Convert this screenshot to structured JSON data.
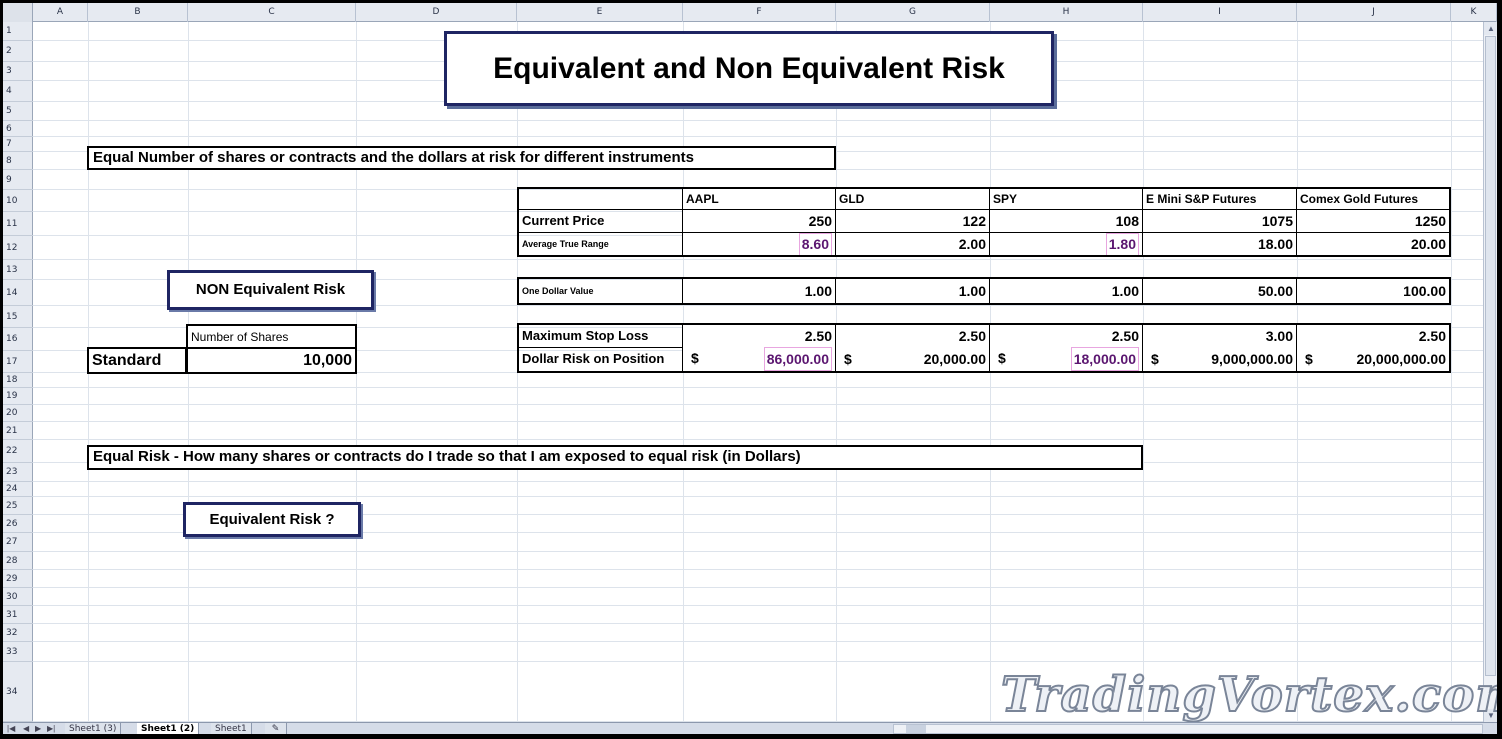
{
  "spreadsheet": {
    "columns": [
      "A",
      "B",
      "C",
      "D",
      "E",
      "F",
      "G",
      "H",
      "I",
      "J",
      "K"
    ],
    "rows": [
      "1",
      "2",
      "3",
      "4",
      "5",
      "6",
      "7",
      "8",
      "9",
      "10",
      "11",
      "12",
      "13",
      "14",
      "15",
      "16",
      "17",
      "18",
      "19",
      "20",
      "21",
      "22",
      "23",
      "24",
      "25",
      "26",
      "27",
      "28",
      "29",
      "30",
      "31",
      "32",
      "33",
      "34"
    ]
  },
  "title": "Equivalent and Non Equivalent Risk",
  "section1": "Equal Number of shares or contracts and the dollars at risk for different instruments",
  "section2": "Equal Risk - How many shares or contracts do I trade so that I am exposed to equal risk (in Dollars)",
  "non_equivalent_label": "NON Equivalent Risk",
  "equivalent_label": "Equivalent Risk ?",
  "shares": {
    "header": "Number of Shares",
    "row_label": "Standard",
    "value": "10,000"
  },
  "instruments": [
    "AAPL",
    "GLD",
    "SPY",
    "E Mini S&P Futures",
    "Comex Gold Futures"
  ],
  "table": {
    "current_price": {
      "label": "Current Price",
      "values": [
        "250",
        "122",
        "108",
        "1075",
        "1250"
      ]
    },
    "atr": {
      "label": "Average True Range",
      "values": [
        "8.60",
        "2.00",
        "1.80",
        "18.00",
        "20.00"
      ]
    },
    "one_dollar": {
      "label": "One Dollar Value",
      "values": [
        "1.00",
        "1.00",
        "1.00",
        "50.00",
        "100.00"
      ]
    },
    "max_stop": {
      "label": "Maximum Stop Loss",
      "values": [
        "2.50",
        "2.50",
        "2.50",
        "3.00",
        "2.50"
      ]
    },
    "dollar_risk": {
      "label": "Dollar Risk on Position",
      "currency": "$",
      "values": [
        "86,000.00",
        "20,000.00",
        "18,000.00",
        "9,000,000.00",
        "20,000,000.00"
      ]
    }
  },
  "sheet_tabs": [
    "Sheet1 (3)",
    "Sheet1 (2)",
    "Sheet1"
  ],
  "active_tab": "Sheet1 (2)",
  "watermark": "TradingVortex.com",
  "colors": {
    "title_border": "#1f2563",
    "highlight_text": "#5b1670",
    "highlight_border": "#e8a6e0"
  }
}
